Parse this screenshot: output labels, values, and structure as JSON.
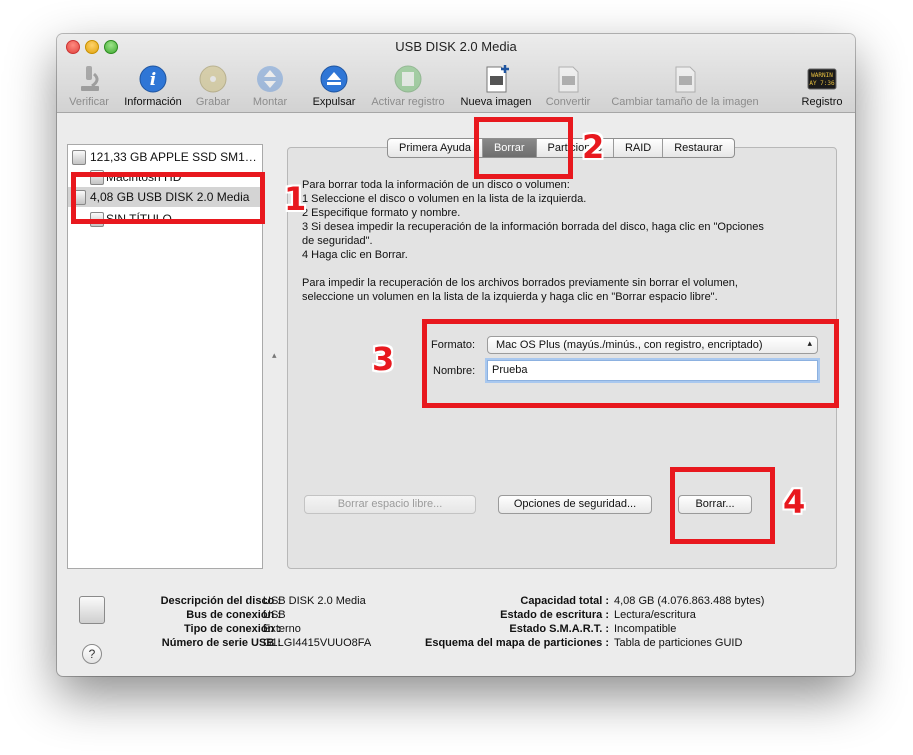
{
  "window": {
    "title": "USB DISK 2.0 Media"
  },
  "toolbar": [
    {
      "label": "Verificar",
      "icon": "microscope-icon",
      "enabled": false
    },
    {
      "label": "Información",
      "icon": "info-icon",
      "enabled": true
    },
    {
      "label": "Grabar",
      "icon": "burn-disc-icon",
      "enabled": false
    },
    {
      "label": "Montar",
      "icon": "mount-icon",
      "enabled": false
    },
    {
      "label": "Expulsar",
      "icon": "eject-icon",
      "enabled": true
    },
    {
      "label": "Activar registro",
      "icon": "journal-icon",
      "enabled": false
    },
    {
      "label": "Nueva imagen",
      "icon": "new-image-icon",
      "enabled": true
    },
    {
      "label": "Convertir",
      "icon": "convert-icon",
      "enabled": false
    },
    {
      "label": "Cambiar tamaño de la imagen",
      "icon": "resize-image-icon",
      "enabled": false
    },
    {
      "label": "Registro",
      "icon": "log-icon",
      "enabled": true
    }
  ],
  "log_icon_text": "WARNIN\nAY 7:36",
  "sidebar": {
    "items": [
      {
        "label": "121,33 GB APPLE SSD SM1…",
        "level": 0,
        "selected": false
      },
      {
        "label": "Macintosh HD",
        "level": 1,
        "selected": false
      },
      {
        "label": "4,08 GB USB DISK 2.0 Media",
        "level": 0,
        "selected": true
      },
      {
        "label": "SIN TÍTULO",
        "level": 1,
        "selected": false
      }
    ]
  },
  "tabs": [
    {
      "label": "Primera Ayuda",
      "selected": false
    },
    {
      "label": "Borrar",
      "selected": true
    },
    {
      "label": "Particiones",
      "selected": false
    },
    {
      "label": "RAID",
      "selected": false
    },
    {
      "label": "Restaurar",
      "selected": false
    }
  ],
  "instructions": {
    "lines": [
      "Para borrar toda la información de un disco o volumen:",
      "1  Seleccione el disco o volumen en la lista de la izquierda.",
      "2  Especifique formato y nombre.",
      "3  Si desea impedir la recuperación de la información borrada del disco, haga clic en \"Opciones",
      "    de seguridad\".",
      "4  Haga clic en Borrar."
    ],
    "free_space_lines": [
      "Para impedir la recuperación de los archivos borrados previamente sin borrar el volumen,",
      "seleccione un volumen en la lista de la izquierda y haga clic en \"Borrar espacio libre\"."
    ]
  },
  "form": {
    "format_label": "Formato:",
    "format_value": "Mac OS Plus (mayús./minús., con registro, encriptado)",
    "name_label": "Nombre:",
    "name_value": "Prueba"
  },
  "buttons": {
    "erase_free_space": "Borrar espacio libre...",
    "security_options": "Opciones de seguridad...",
    "erase": "Borrar..."
  },
  "disk_info": {
    "left": [
      {
        "key": "Descripción del disco :",
        "value": "USB DISK 2.0 Media"
      },
      {
        "key": "Bus de conexión :",
        "value": "USB"
      },
      {
        "key": "Tipo de conexión :",
        "value": "Externo"
      },
      {
        "key": "Número de serie USB :",
        "value": "G1LGI4415VUUO8FA"
      }
    ],
    "right": [
      {
        "key": "Capacidad total :",
        "value": "4,08 GB (4.076.863.488 bytes)"
      },
      {
        "key": "Estado de escritura :",
        "value": "Lectura/escritura"
      },
      {
        "key": "Estado S.M.A.R.T. :",
        "value": "Incompatible"
      },
      {
        "key": "Esquema del mapa de particiones :",
        "value": "Tabla de particiones GUID"
      }
    ]
  },
  "help_label": "?",
  "annotations": [
    "1",
    "2",
    "3",
    "4"
  ],
  "colors": {
    "annotation": "#e8181e",
    "selection": "#d4d4d4",
    "tab_selected": "#7a7a7a",
    "focus_ring": "#a9c8ef"
  }
}
